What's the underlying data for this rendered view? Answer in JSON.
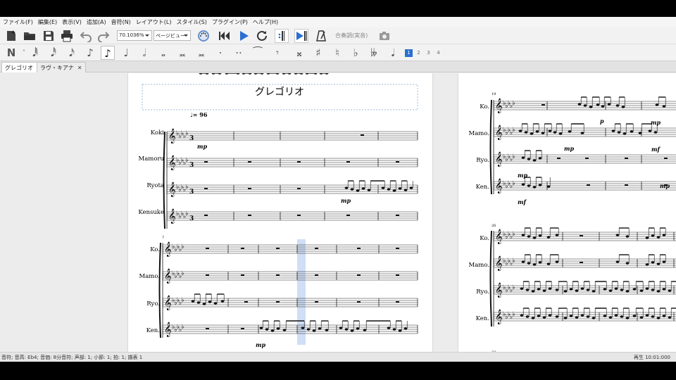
{
  "menu": {
    "items": [
      "ファイル(F)",
      "編集(E)",
      "表示(V)",
      "追加(A)",
      "音符(N)",
      "レイアウト(L)",
      "スタイル(S)",
      "プラグイン(P)",
      "ヘルプ(H)"
    ]
  },
  "toolbar": {
    "zoom_value": "70.1036%",
    "view_mode": "ページビュー",
    "concert_pitch_label": "合奏調(実音)"
  },
  "voices": [
    "1",
    "2",
    "3",
    "4"
  ],
  "tabs": [
    {
      "label": "グレゴリオ",
      "close": "✕"
    },
    {
      "label": "ラヴ・キアナ",
      "close": "✕"
    }
  ],
  "score": {
    "title": "グレゴリオ",
    "tempo_text": "♩= 96",
    "page1": {
      "system1": {
        "measure_start": "",
        "instruments": [
          "Koki",
          "Mamoru",
          "Ryota",
          "Kensuke"
        ],
        "dynamics": [
          "mp",
          "mp"
        ]
      },
      "system2": {
        "measure_start": "7",
        "instruments": [
          "Ko.",
          "Mamo.",
          "Ryo.",
          "Ken."
        ],
        "dynamics": [
          "mp"
        ]
      }
    },
    "page2": {
      "system1": {
        "measure_start": "19",
        "instruments": [
          "Ko.",
          "Mamo.",
          "Ryo.",
          "Ken."
        ],
        "dynamics": [
          "p",
          "mp",
          "mp",
          "mf",
          "mp",
          "mf",
          "mp"
        ]
      },
      "system2": {
        "measure_start": "26",
        "instruments": [
          "Ko.",
          "Mamo.",
          "Ryo.",
          "Ken."
        ]
      },
      "system3": {
        "measure_start": "32"
      }
    }
  },
  "status": {
    "left": "音符; 音高: Eb4; 音価: 8分音符; 声部: 1;  小節: 1; 拍: 1; 譜表 1",
    "right": "再生  10:01:000"
  }
}
